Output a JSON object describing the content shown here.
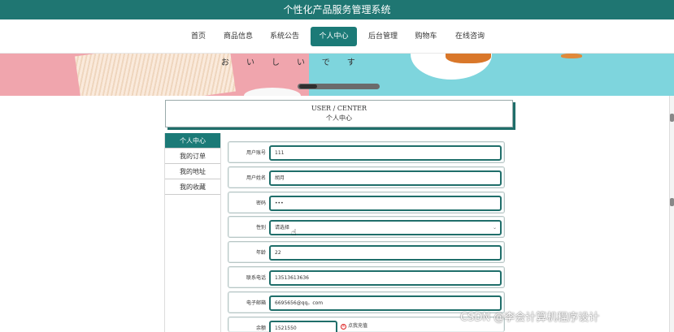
{
  "app": {
    "title": "个性化产品服务管理系统"
  },
  "nav": {
    "items": [
      {
        "label": "首页"
      },
      {
        "label": "商品信息"
      },
      {
        "label": "系统公告"
      },
      {
        "label": "个人中心"
      },
      {
        "label": "后台管理"
      },
      {
        "label": "购物车"
      },
      {
        "label": "在线咨询"
      }
    ],
    "active": "个人中心"
  },
  "banner": {
    "text": "おいしいです"
  },
  "section": {
    "title_en": "USER / CENTER",
    "title_zh": "个人中心"
  },
  "sidebar": {
    "items": [
      {
        "label": "个人中心"
      },
      {
        "label": "我的订单"
      },
      {
        "label": "我的地址"
      },
      {
        "label": "我的收藏"
      }
    ]
  },
  "form": {
    "account": {
      "label": "用户账号",
      "value": "111"
    },
    "name": {
      "label": "用户姓名",
      "value": "胡月"
    },
    "password": {
      "label": "密码",
      "value": "•••"
    },
    "gender": {
      "label": "性别",
      "value": "请选择"
    },
    "age": {
      "label": "年龄",
      "value": "22"
    },
    "phone": {
      "label": "联系电话",
      "value": "13513613636"
    },
    "email": {
      "label": "电子邮箱",
      "value": "6695656@qq。com"
    },
    "balance": {
      "label": "余额",
      "value": "1521550",
      "recharge_label": "点我充值"
    }
  },
  "watermark": {
    "text": "CSDN @李会计算机程序设计"
  },
  "colors": {
    "primary": "#1b7a77",
    "title_bar": "#1f7672",
    "banner_pink": "#f0a5ad",
    "banner_cyan": "#7ed5dd"
  },
  "icons": {
    "select": "chevron-down-icon",
    "recharge": "recharge-icon",
    "cursor": "hand-cursor-icon"
  }
}
